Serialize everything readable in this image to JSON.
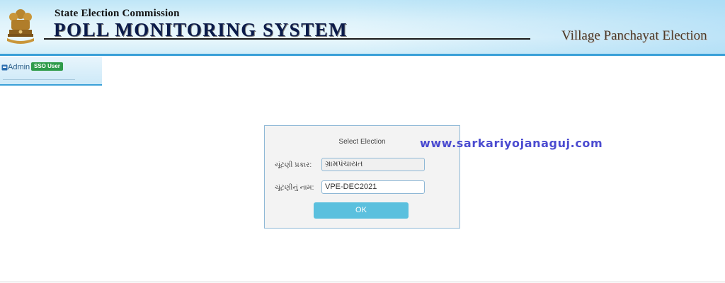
{
  "header": {
    "commission": "State Election Commission",
    "system_title": "POLL MONITORING SYSTEM",
    "election_type": "Village Panchayat Election",
    "emblem_icon": "national-emblem-icon"
  },
  "user_panel": {
    "role": "Admin",
    "badge": "SSO User",
    "icon": "book-icon"
  },
  "dialog": {
    "title": "Select Election",
    "fields": [
      {
        "label": "ચૂંટણી પ્રકાર:",
        "value": "ગ્રામપંચાયત"
      },
      {
        "label": "ચૂંટણીનું નામ:",
        "value": "VPE-DEC2021"
      }
    ],
    "ok_label": "OK"
  },
  "watermark": "www.sarkariyojanaguj.com",
  "colors": {
    "header_accent": "#3aa0d8",
    "button": "#5bc0de",
    "badge": "#2e9b4a",
    "watermark": "#4b4bd0"
  }
}
